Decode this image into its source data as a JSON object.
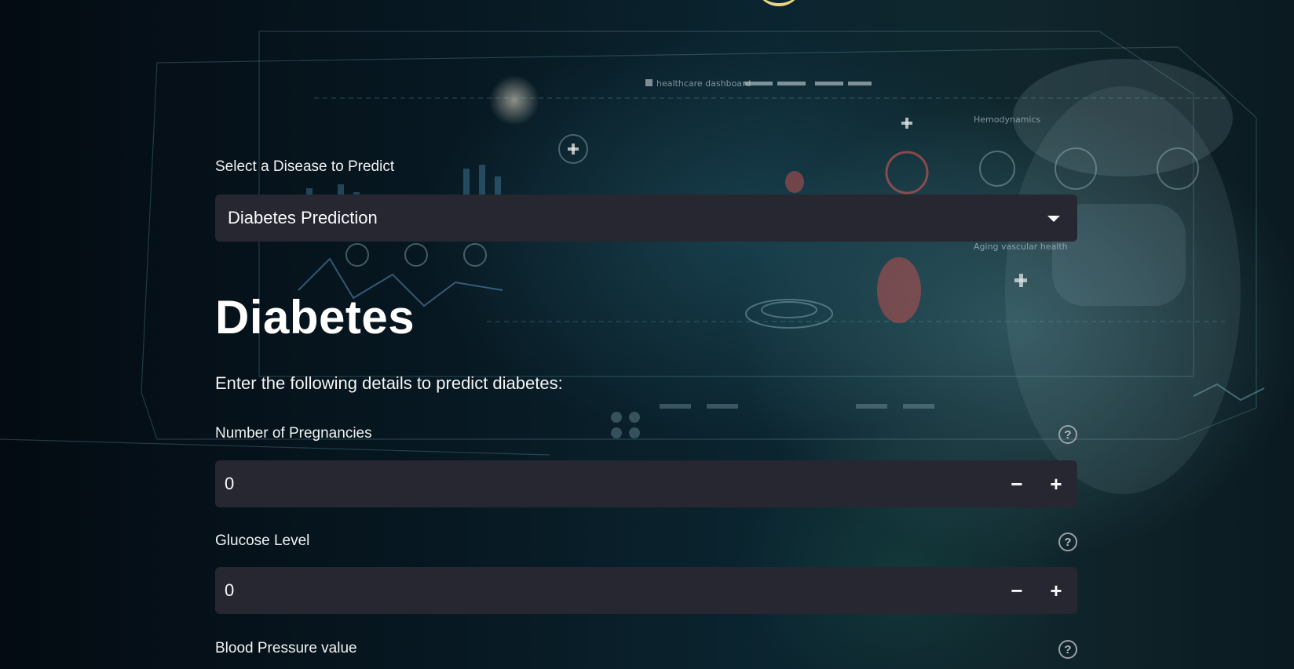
{
  "disease_select": {
    "label": "Select a Disease to Predict",
    "selected": "Diabetes Prediction"
  },
  "page": {
    "title": "Diabetes",
    "subtitle": "Enter the following details to predict diabetes:"
  },
  "fields": [
    {
      "label": "Number of Pregnancies",
      "value": "0"
    },
    {
      "label": "Glucose Level",
      "value": "0"
    },
    {
      "label": "Blood Pressure value"
    }
  ],
  "stepper": {
    "minus": "−",
    "plus": "+"
  },
  "help_glyph": "?",
  "background": {
    "dashboard_header": "healthcare dashboard",
    "hemodynamics": "Hemodynamics",
    "aging": "Aging vascular health"
  },
  "colors": {
    "input_bg": "#262730",
    "text": "#fafafa",
    "accent_logo": "#e9d77a"
  }
}
